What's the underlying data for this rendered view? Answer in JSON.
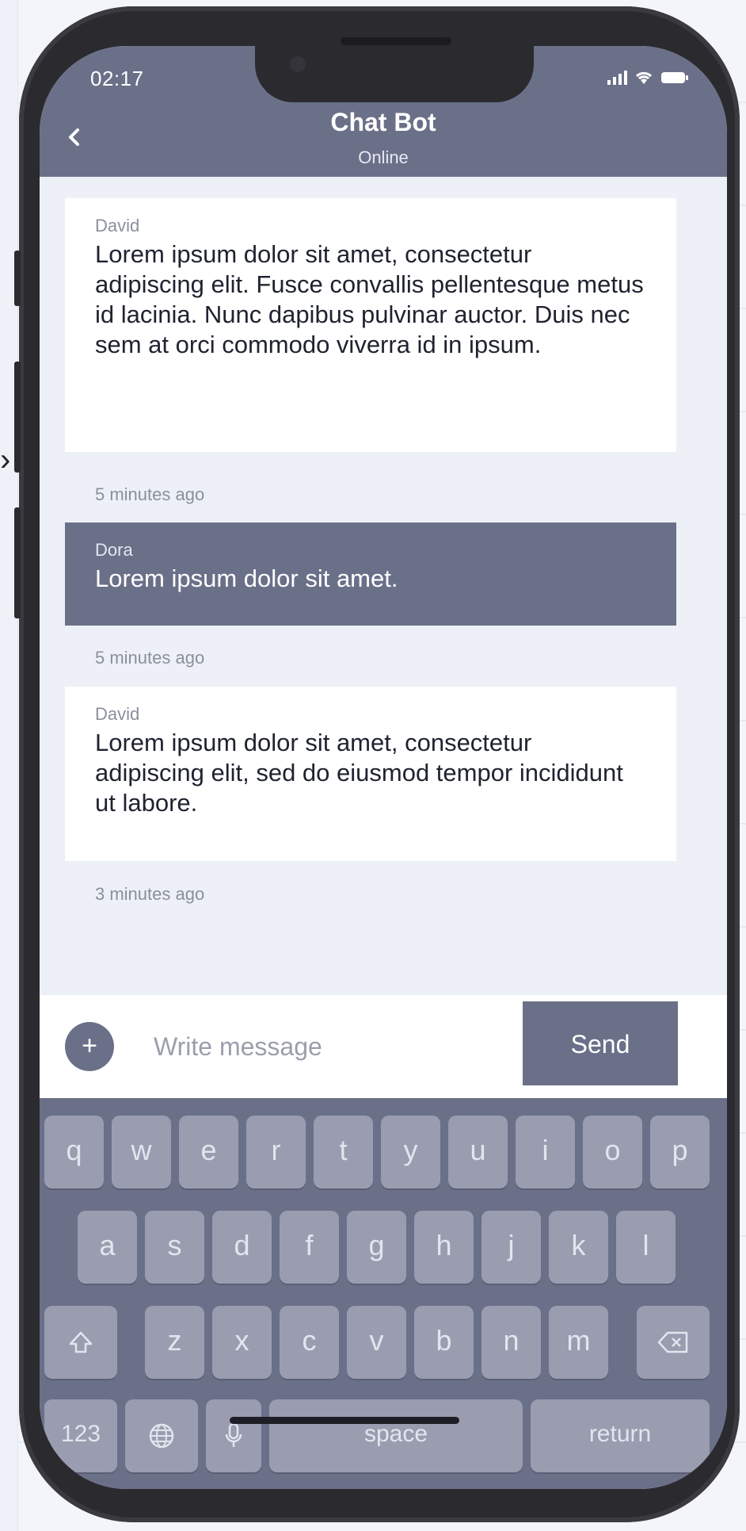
{
  "status_bar": {
    "time": "02:17"
  },
  "header": {
    "title": "Chat Bot",
    "subtitle": "Online"
  },
  "messages": [
    {
      "sender": "David",
      "text": "Lorem ipsum dolor sit amet, consectetur adipiscing elit. Fusce convallis pellentesque metus id lacinia. Nunc dapibus pulvinar auctor. Duis nec sem at orci commodo viverra id in ipsum.",
      "time": "5 minutes ago"
    },
    {
      "sender": "Dora",
      "text": "Lorem ipsum dolor sit amet.",
      "time": "5 minutes ago"
    },
    {
      "sender": "David",
      "text": "Lorem ipsum dolor sit amet, consectetur adipiscing elit, sed do eiusmod tempor incididunt ut labore.",
      "time": "3 minutes ago"
    }
  ],
  "compose": {
    "add": "+",
    "placeholder": "Write message",
    "send": "Send"
  },
  "keyboard": {
    "row1": [
      "q",
      "w",
      "e",
      "r",
      "t",
      "y",
      "u",
      "i",
      "o",
      "p"
    ],
    "row2": [
      "a",
      "s",
      "d",
      "f",
      "g",
      "h",
      "j",
      "k",
      "l"
    ],
    "row3": [
      "z",
      "x",
      "c",
      "v",
      "b",
      "n",
      "m"
    ],
    "num": "123",
    "space": "space",
    "return": "return"
  },
  "colors": {
    "accent": "#6b7089",
    "screen_bg": "#edf1f7",
    "bubble_in": "#ffffff"
  }
}
